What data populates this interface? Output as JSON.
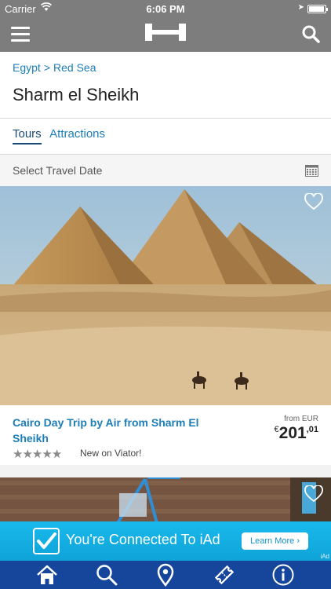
{
  "status_bar": {
    "carrier": "Carrier",
    "time": "6:06 PM"
  },
  "nav": {
    "menu_icon": "hamburger-icon",
    "logo_icon": "hotels-logo",
    "search_icon": "search-icon"
  },
  "breadcrumb": {
    "country": "Egypt",
    "separator": ">",
    "region": "Red Sea"
  },
  "page_title": "Sharm el Sheikh",
  "tabs": [
    {
      "label": "Tours",
      "active": true
    },
    {
      "label": "Attractions",
      "active": false
    }
  ],
  "date_picker": {
    "label": "Select Travel Date",
    "icon": "calendar-icon"
  },
  "tours": [
    {
      "title": "Cairo Day Trip by Air from Sharm El Sheikh",
      "price_from": "from EUR",
      "currency": "€",
      "price_whole": "201",
      "price_cents": ",01",
      "rating_note": "New on Viator!",
      "stars": 5,
      "image": "pyramids-of-giza-photo"
    },
    {
      "image": "playground-photo"
    }
  ],
  "ad": {
    "text": "You're Connected To iAd",
    "button": "Learn More",
    "corner": "iAd"
  },
  "tab_bar": [
    {
      "icon": "home-icon"
    },
    {
      "icon": "search-icon"
    },
    {
      "icon": "map-pin-icon"
    },
    {
      "icon": "ticket-icon"
    },
    {
      "icon": "info-icon"
    }
  ],
  "colors": {
    "nav_gray": "#7d7d7d",
    "link_blue": "#1c7db8",
    "tab_bar_blue": "#16469b",
    "ad_blue": "#19b9ec"
  }
}
